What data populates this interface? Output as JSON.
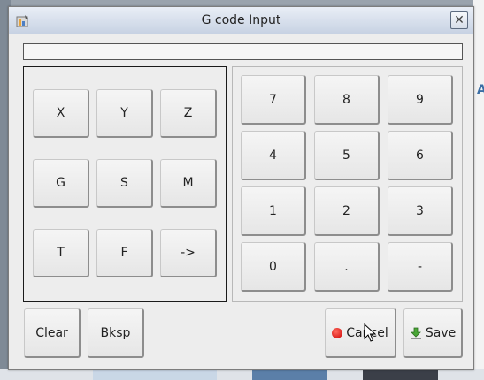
{
  "window": {
    "title": "G code Input",
    "close_glyph": "✕"
  },
  "gcode_display": {
    "value": ""
  },
  "letter_keys": [
    [
      "X",
      "Y",
      "Z"
    ],
    [
      "G",
      "S",
      "M"
    ],
    [
      "T",
      "F",
      "->"
    ]
  ],
  "digit_keys": [
    [
      "7",
      "8",
      "9"
    ],
    [
      "4",
      "5",
      "6"
    ],
    [
      "1",
      "2",
      "3"
    ],
    [
      "0",
      ".",
      "-"
    ]
  ],
  "actions": {
    "clear": "Clear",
    "bksp": "Bksp",
    "cancel": "Cancel",
    "save": "Save"
  },
  "background": {
    "right_text": "A"
  },
  "colors": {
    "cancel_icon": "#d40000",
    "save_icon": "#3a9a2a",
    "titlebar": "#c7d2e3"
  },
  "icons": {
    "app": "app-icon",
    "cancel": "red-circle-icon",
    "save": "save-arrow-icon"
  }
}
